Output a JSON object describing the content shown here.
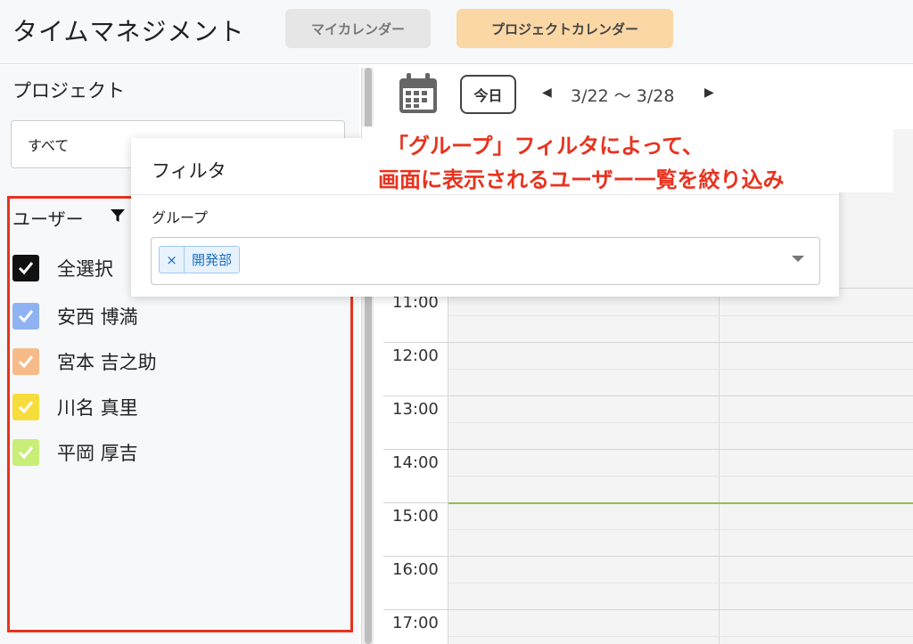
{
  "header": {
    "app_title": "タイムマネジメント",
    "tab_my": "マイカレンダー",
    "tab_project": "プロジェクトカレンダー"
  },
  "sidebar": {
    "project_label": "プロジェクト",
    "project_value": "すべて",
    "users_title": "ユーザー",
    "users": [
      {
        "label": "全選択",
        "color": "#111111"
      },
      {
        "label": "安西 博満",
        "color": "#8fb3f2"
      },
      {
        "label": "宮本 吉之助",
        "color": "#f7bb8a"
      },
      {
        "label": "川名 真里",
        "color": "#f7dd3c"
      },
      {
        "label": "平岡 厚吉",
        "color": "#c9ee77"
      }
    ]
  },
  "calendar": {
    "today_label": "今日",
    "prev_icon": "◀",
    "next_icon": "▶",
    "date_range": "3/22 〜 3/28",
    "times": [
      "11:00",
      "12:00",
      "13:00",
      "14:00",
      "15:00",
      "16:00",
      "17:00"
    ]
  },
  "filter_popup": {
    "title": "フィルタ",
    "group_label": "グループ",
    "tag_remove": "×",
    "tag_value": "開発部"
  },
  "annotation": {
    "line1": "「グループ」フィルタによって、",
    "line2": "画面に表示されるユーザー一覧を絞り込み"
  },
  "colors": {
    "accent_red": "#e8321e",
    "tab_active_bg": "#fbd7a6",
    "now_line": "#8bc34a"
  }
}
